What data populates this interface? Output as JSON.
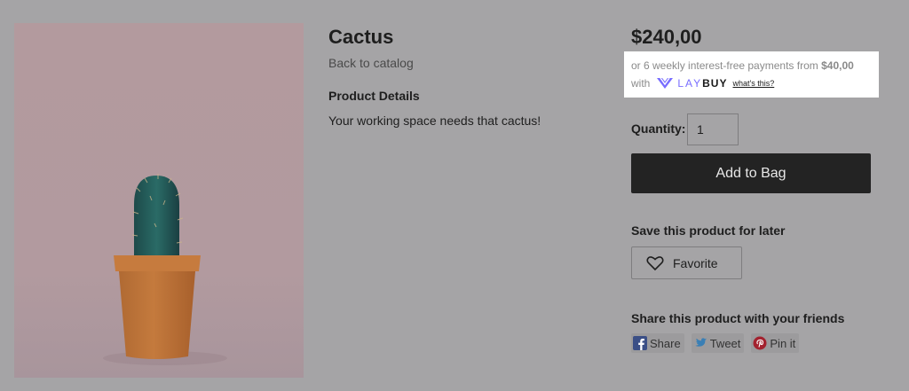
{
  "product": {
    "title": "Cactus",
    "back_link": "Back to catalog",
    "details_heading": "Product Details",
    "details_text": "Your working space needs that cactus!",
    "image_icon": "cactus-photo",
    "price": "$240,00"
  },
  "laybuy": {
    "line1_prefix": "or 6 weekly interest-free payments from",
    "installment": "$40,00",
    "with": "with",
    "logo_lay": "LAY",
    "logo_buy": "BUY",
    "whats_this": "what's this?",
    "accent_color": "#786dff"
  },
  "purchase": {
    "quantity_label": "Quantity:",
    "quantity_value": "1",
    "add_to_bag": "Add to Bag"
  },
  "save": {
    "heading": "Save this product for later",
    "favorite_label": "Favorite"
  },
  "share": {
    "heading": "Share this product with your friends",
    "buttons": [
      {
        "label": "Share",
        "icon": "facebook-icon"
      },
      {
        "label": "Tweet",
        "icon": "twitter-icon"
      },
      {
        "label": "Pin it",
        "icon": "pinterest-icon"
      }
    ]
  }
}
